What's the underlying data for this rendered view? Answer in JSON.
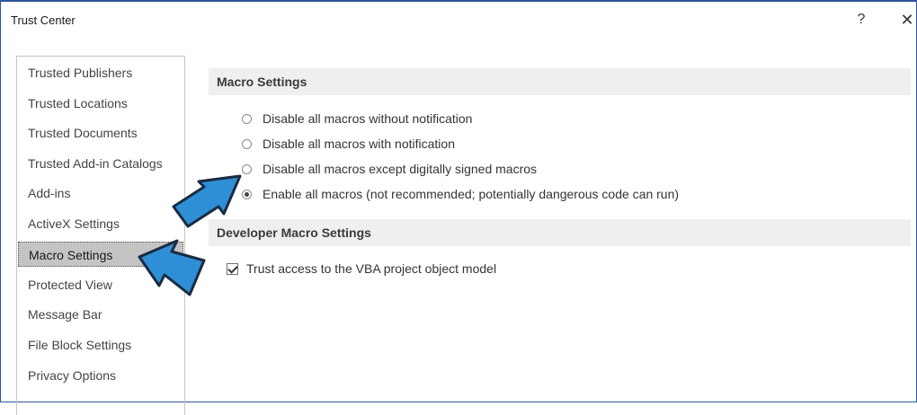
{
  "window": {
    "title": "Trust Center",
    "help_label": "?",
    "close_label": "✕"
  },
  "nav": {
    "items": [
      "Trusted Publishers",
      "Trusted Locations",
      "Trusted Documents",
      "Trusted Add-in Catalogs",
      "Add-ins",
      "ActiveX Settings",
      "Macro Settings",
      "Protected View",
      "Message Bar",
      "File Block Settings",
      "Privacy Options"
    ],
    "selected": "Macro Settings"
  },
  "macro_settings": {
    "heading": "Macro Settings",
    "options": [
      {
        "label": "Disable all macros without notification",
        "checked": false
      },
      {
        "label": "Disable all macros with notification",
        "checked": false
      },
      {
        "label": "Disable all macros except digitally signed macros",
        "checked": false
      },
      {
        "label": "Enable all macros (not recommended; potentially dangerous code can run)",
        "checked": true
      }
    ]
  },
  "developer_macro_settings": {
    "heading": "Developer Macro Settings",
    "trust_vba_label": "Trust access to the VBA project object model",
    "trust_vba_checked": true
  },
  "annotations": {
    "arrow_color": "#2e8fd6",
    "arrow_outline": "#1a2a40"
  }
}
